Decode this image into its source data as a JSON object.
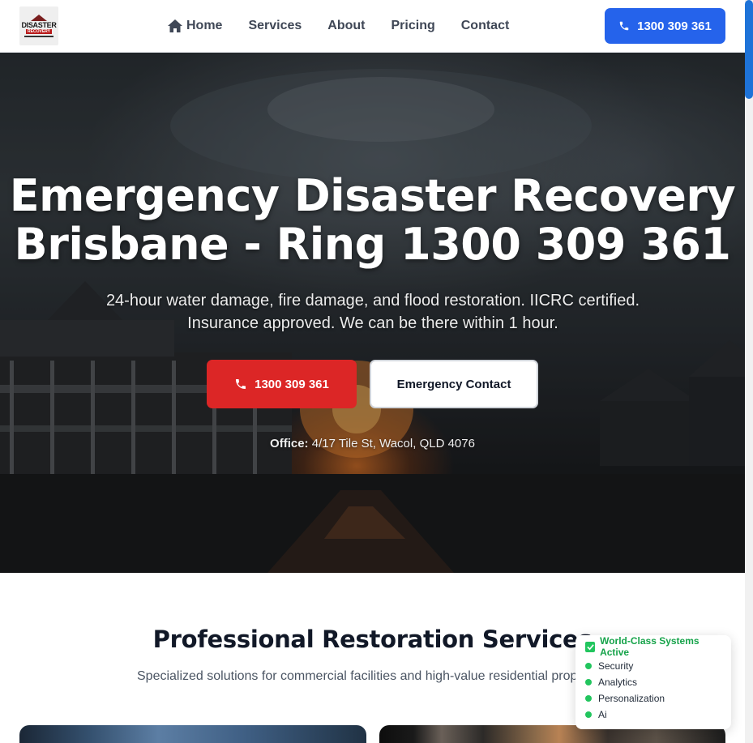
{
  "brand": {
    "logo_text": "DISASTER",
    "logo_subtext": "RECOVERY"
  },
  "nav": {
    "items": [
      {
        "label": "Home",
        "icon": "home-icon"
      },
      {
        "label": "Services"
      },
      {
        "label": "About"
      },
      {
        "label": "Pricing"
      },
      {
        "label": "Contact"
      }
    ],
    "phone_button": {
      "label": "1300 309 361",
      "icon": "phone-icon"
    }
  },
  "hero": {
    "title_line1": "Emergency Disaster Recovery",
    "title_line2": "Brisbane - Ring 1300 309 361",
    "subtitle_line1": "24-hour water damage, fire damage, and flood restoration. IICRC certified.",
    "subtitle_line2": "Insurance approved. We can be there within 1 hour.",
    "call_button": "1300 309 361",
    "emergency_button": "Emergency Contact",
    "office_label": "Office:",
    "office_address": "4/17 Tile St, Wacol, QLD 4076"
  },
  "services": {
    "title": "Professional Restoration Services",
    "subtitle": "Specialized solutions for commercial facilities and high-value residential prop"
  },
  "status_widget": {
    "title": "World-Class Systems Active",
    "items": [
      "Security",
      "Analytics",
      "Personalization",
      "Ai"
    ]
  },
  "colors": {
    "nav_phone_bg": "#2563eb",
    "call_button_bg": "#dc2626",
    "status_green": "#22c55e",
    "scroll_thumb": "#1e73d8"
  }
}
